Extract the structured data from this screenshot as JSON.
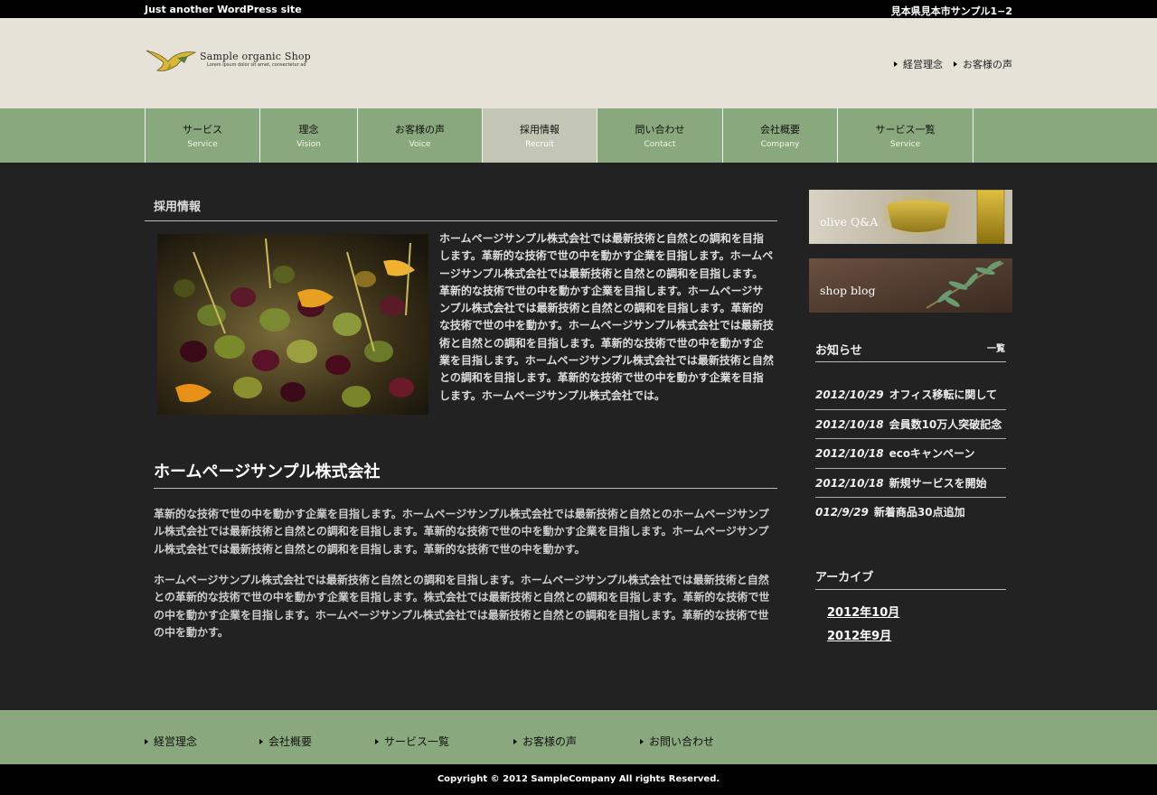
{
  "topbar": {
    "tagline": "Just another WordPress site",
    "address": "見本県見本市サンプル1−2"
  },
  "header": {
    "logo_name": "Sample organic Shop",
    "logo_sub": "Lorem ipsum dolor sit amet, consectetur ad",
    "links": [
      "経営理念",
      "お客様の声"
    ]
  },
  "nav": [
    {
      "jp": "サービス",
      "en": "Service"
    },
    {
      "jp": "理念",
      "en": "Vision"
    },
    {
      "jp": "お客様の声",
      "en": "Voice"
    },
    {
      "jp": "採用情報",
      "en": "Recruit",
      "active": true
    },
    {
      "jp": "問い合わせ",
      "en": "Contact"
    },
    {
      "jp": "会社概要",
      "en": "Company"
    },
    {
      "jp": "サービス一覧",
      "en": "Service"
    }
  ],
  "main": {
    "page_title": "採用情報",
    "intro": "ホームページサンプル株式会社では最新技術と自然との調和を目指します。革新的な技術で世の中を動かす企業を目指します。ホームページサンプル株式会社では最新技術と自然との調和を目指します。革新的な技術で世の中を動かす企業を目指します。ホームページサンプル株式会社では最新技術と自然との調和を目指します。革新的な技術で世の中を動かす。ホームページサンプル株式会社では最新技術と自然との調和を目指します。革新的な技術で世の中を動かす企業を目指します。ホームページサンプル株式会社では最新技術と自然との調和を目指します。革新的な技術で世の中を動かす企業を目指します。ホームページサンプル株式会社では。",
    "company_name": "ホームページサンプル株式会社",
    "para1": "革新的な技術で世の中を動かす企業を目指します。ホームページサンプル株式会社では最新技術と自然とのホームページサンプル株式会社では最新技術と自然との調和を目指します。革新的な技術で世の中を動かす企業を目指します。ホームページサンプル株式会社では最新技術と自然との調和を目指します。革新的な技術で世の中を動かす。",
    "para2": "ホームページサンプル株式会社では最新技術と自然との調和を目指します。ホームページサンプル株式会社では最新技術と自然との革新的な技術で世の中を動かす企業を目指します。株式会社では最新技術と自然との調和を目指します。革新的な技術で世の中を動かす企業を目指します。ホームページサンプル株式会社では最新技術と自然との調和を目指します。革新的な技術で世の中を動かす。"
  },
  "sidebar": {
    "banner1": "olive Q&A",
    "banner2": "shop blog",
    "news_heading": "お知らせ",
    "news_all": "一覧",
    "news": [
      {
        "date": "2012/10/29",
        "text": "オフィス移転に関して"
      },
      {
        "date": "2012/10/18",
        "text": "会員数10万人突破記念"
      },
      {
        "date": "2012/10/18",
        "text": "ecoキャンペーン"
      },
      {
        "date": "2012/10/18",
        "text": "新規サービスを開始"
      },
      {
        "date": "012/9/29",
        "text": "新着商品30点追加"
      }
    ],
    "archive_heading": "アーカイブ",
    "archives": [
      "2012年10月",
      "2012年9月"
    ]
  },
  "footer": {
    "links": [
      "経営理念",
      "会社概要",
      "サービス一覧",
      "お客様の声",
      "お問い合わせ"
    ],
    "copyright": "Copyright © 2012 SampleCompany All rights Reserved."
  },
  "colors": {
    "nav_green": "#8aa87d",
    "header_beige": "#e6e2d8",
    "body_dark": "#222222",
    "nav_active": "#c3c5b5"
  }
}
